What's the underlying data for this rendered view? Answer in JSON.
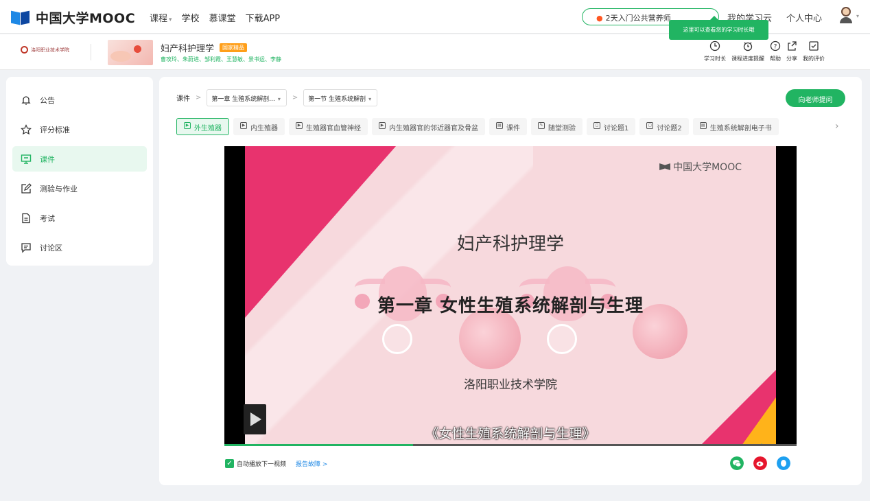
{
  "nav": {
    "logo_text": "中国大学MOOC",
    "links": [
      {
        "label": "课程",
        "caret": "▾"
      },
      {
        "label": "学校",
        "caret": ""
      },
      {
        "label": "慕课堂",
        "caret": ""
      },
      {
        "label": "下载APP",
        "caret": ""
      }
    ],
    "promo_text": "2天入门公共营养师",
    "right_link": "我的学习云",
    "personal_center": "个人中心",
    "avatar_caret": "▾",
    "tooltip": "这里可以查看您的学习时长哦"
  },
  "course": {
    "school_name": "洛阳职业技术学院",
    "title": "妇产科护理学",
    "badge": "国家精品",
    "teachers": "曹攻玲、朱蔚进、邹利霞、王慧敏、景书运、李静",
    "actions": [
      {
        "label": "学习时长",
        "icon": "clock-icon"
      },
      {
        "label": "课程进度提醒",
        "icon": "progress-alarm-icon"
      },
      {
        "label": "帮助",
        "icon": "help-icon"
      },
      {
        "label": "分享",
        "icon": "share-icon"
      },
      {
        "label": "我的评价",
        "icon": "review-icon"
      }
    ]
  },
  "sidebar": {
    "items": [
      {
        "label": "公告",
        "icon": "bell-icon",
        "active": false
      },
      {
        "label": "评分标准",
        "icon": "star-icon",
        "active": false
      },
      {
        "label": "课件",
        "icon": "courseware-icon",
        "active": true
      },
      {
        "label": "测验与作业",
        "icon": "edit-icon",
        "active": false
      },
      {
        "label": "考试",
        "icon": "exam-icon",
        "active": false
      },
      {
        "label": "讨论区",
        "icon": "discussion-icon",
        "active": false
      }
    ]
  },
  "main": {
    "crumb_root": "课件",
    "chapter_select": "第一章 生殖系统解剖...",
    "section_select": "第一节 生殖系统解剖",
    "ask_button": "向老师提问",
    "tabs": [
      {
        "label": "外生殖器",
        "icon": "▶",
        "active": true
      },
      {
        "label": "内生殖器",
        "icon": "▶",
        "active": false
      },
      {
        "label": "生殖器官血管神经",
        "icon": "▶",
        "active": false
      },
      {
        "label": "内生殖器官的邻近器官及骨盆",
        "icon": "▶",
        "active": false
      },
      {
        "label": "课件",
        "icon": "▤",
        "active": false
      },
      {
        "label": "随堂测验",
        "icon": "✎",
        "active": false
      },
      {
        "label": "讨论题1",
        "icon": "◻",
        "active": false
      },
      {
        "label": "讨论题2",
        "icon": "◻",
        "active": false
      },
      {
        "label": "生殖系统解剖电子书",
        "icon": "▤",
        "active": false
      }
    ],
    "tabs_next": "›",
    "video": {
      "watermark": "中国大学MOOC",
      "slide_title": "妇产科护理学",
      "slide_chapter": "第一章  女性生殖系统解剖与生理",
      "slide_school": "洛阳职业技术学院",
      "subtitle": "《女性生殖系统解剖与生理》",
      "progress": 0.33
    },
    "autoplay_label": "自动播放下一视频",
    "autoplay_checked": true,
    "report_label": "报告故障 >",
    "share_icons": [
      {
        "name": "wechat-share-icon",
        "color": "#21b462"
      },
      {
        "name": "weibo-share-icon",
        "color": "#e6162d"
      },
      {
        "name": "qq-share-icon",
        "color": "#1ea0f0"
      }
    ]
  },
  "colors": {
    "accent": "#21b462",
    "slide_pink": "#e8336e",
    "badge": "#ff9f1a"
  }
}
